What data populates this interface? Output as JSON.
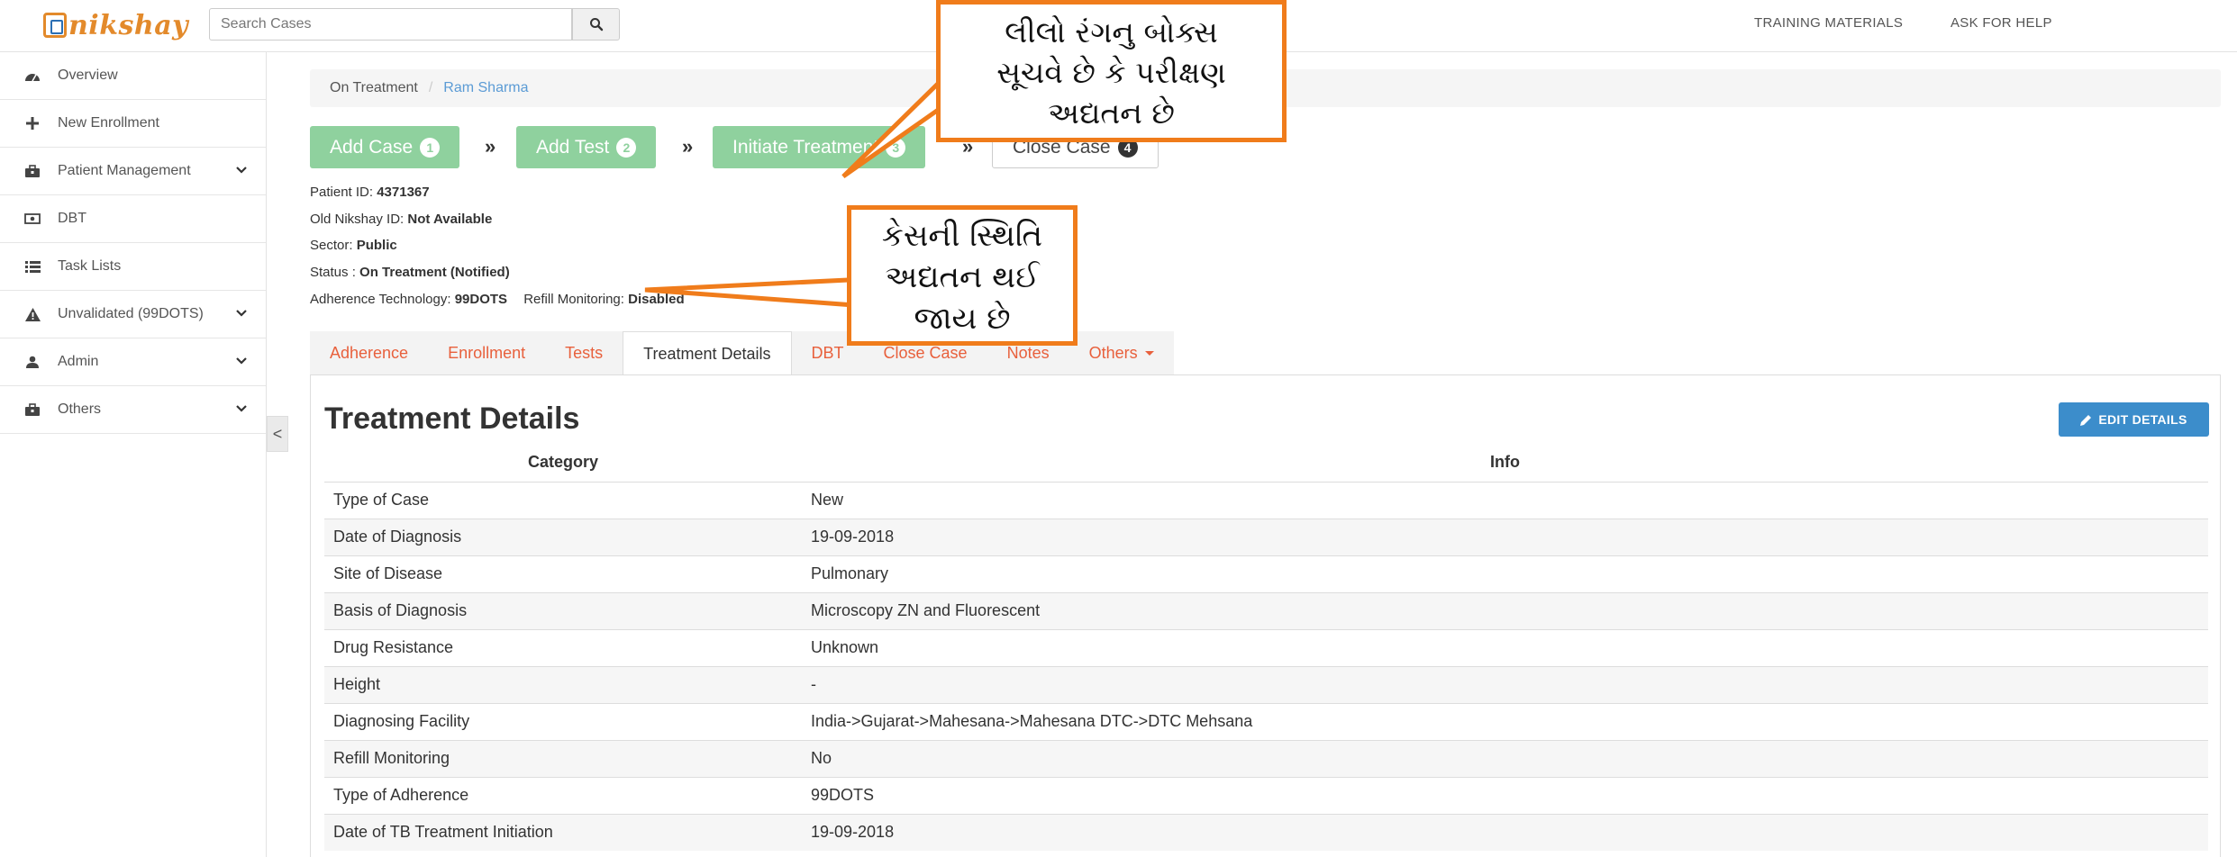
{
  "app": {
    "logo_text": "nikshay",
    "search": {
      "placeholder": "Search Cases"
    },
    "top_links": [
      "TRAINING MATERIALS",
      "ASK FOR HELP"
    ]
  },
  "sidebar": {
    "items": [
      {
        "label": "Overview",
        "icon": "dashboard-icon",
        "has_chevron": false
      },
      {
        "label": "New Enrollment",
        "icon": "plus-icon",
        "has_chevron": false
      },
      {
        "label": "Patient Management",
        "icon": "briefcase-icon",
        "has_chevron": true
      },
      {
        "label": "DBT",
        "icon": "money-icon",
        "has_chevron": false
      },
      {
        "label": "Task Lists",
        "icon": "list-icon",
        "has_chevron": false
      },
      {
        "label": "Unvalidated (99DOTS)",
        "icon": "warning-icon",
        "has_chevron": true
      },
      {
        "label": "Admin",
        "icon": "user-icon",
        "has_chevron": true
      },
      {
        "label": "Others",
        "icon": "briefcase-icon",
        "has_chevron": true
      }
    ],
    "collapse_glyph": "<"
  },
  "breadcrumb": {
    "parent": "On Treatment",
    "separator": "/",
    "current": "Ram Sharma"
  },
  "steps": [
    {
      "label": "Add Case",
      "badge": "1",
      "state": "done"
    },
    {
      "label": "Add Test",
      "badge": "2",
      "state": "done"
    },
    {
      "label": "Initiate Treatment",
      "badge": "3",
      "state": "done"
    },
    {
      "label": "Close Case",
      "badge": "4",
      "state": "pending"
    }
  ],
  "step_separator": "»",
  "patient": {
    "id_label": "Patient ID:",
    "id_value": "4371367",
    "old_id_label": "Old Nikshay ID:",
    "old_id_value": "Not Available",
    "sector_label": "Sector:",
    "sector_value": "Public",
    "status_label": "Status :",
    "status_value": "On Treatment (Notified)",
    "adherence_label": "Adherence Technology:",
    "adherence_value": "99DOTS",
    "refill_label": "Refill Monitoring:",
    "refill_value": "Disabled"
  },
  "tabs": [
    {
      "label": "Adherence",
      "active": false
    },
    {
      "label": "Enrollment",
      "active": false
    },
    {
      "label": "Tests",
      "active": false
    },
    {
      "label": "Treatment Details",
      "active": true
    },
    {
      "label": "DBT",
      "active": false
    },
    {
      "label": "Close Case",
      "active": false
    },
    {
      "label": "Notes",
      "active": false
    },
    {
      "label": "Others",
      "active": false,
      "dropdown": true
    }
  ],
  "section": {
    "title": "Treatment Details",
    "edit_label": "EDIT DETAILS"
  },
  "table": {
    "headers": [
      "Category",
      "Info"
    ],
    "rows": [
      [
        "Type of Case",
        "New"
      ],
      [
        "Date of Diagnosis",
        "19-09-2018"
      ],
      [
        "Site of Disease",
        "Pulmonary"
      ],
      [
        "Basis of Diagnosis",
        "Microscopy ZN and Fluorescent"
      ],
      [
        "Drug Resistance",
        "Unknown"
      ],
      [
        "Height",
        "-"
      ],
      [
        "Diagnosing Facility",
        "India->Gujarat->Mahesana->Mahesana DTC->DTC Mehsana"
      ],
      [
        "Refill Monitoring",
        "No"
      ],
      [
        "Type of Adherence",
        "99DOTS"
      ],
      [
        "Date of TB Treatment Initiation",
        "19-09-2018"
      ]
    ]
  },
  "callouts": [
    {
      "lines": [
        "લીલો રંગનુ બોક્સ",
        "સૂચવે છે કે પરીક્ષણ",
        "અદ્યતન છે"
      ]
    },
    {
      "lines": [
        "કેસની સ્થિતિ",
        "અદ્યતન થઈ",
        "જાય છે"
      ]
    }
  ],
  "colors": {
    "accent_orange": "#f07c1b",
    "step_green": "#8fd19e",
    "tab_text": "#e8603c",
    "edit_blue": "#3c8dcb",
    "link_blue": "#5b9bd5"
  }
}
